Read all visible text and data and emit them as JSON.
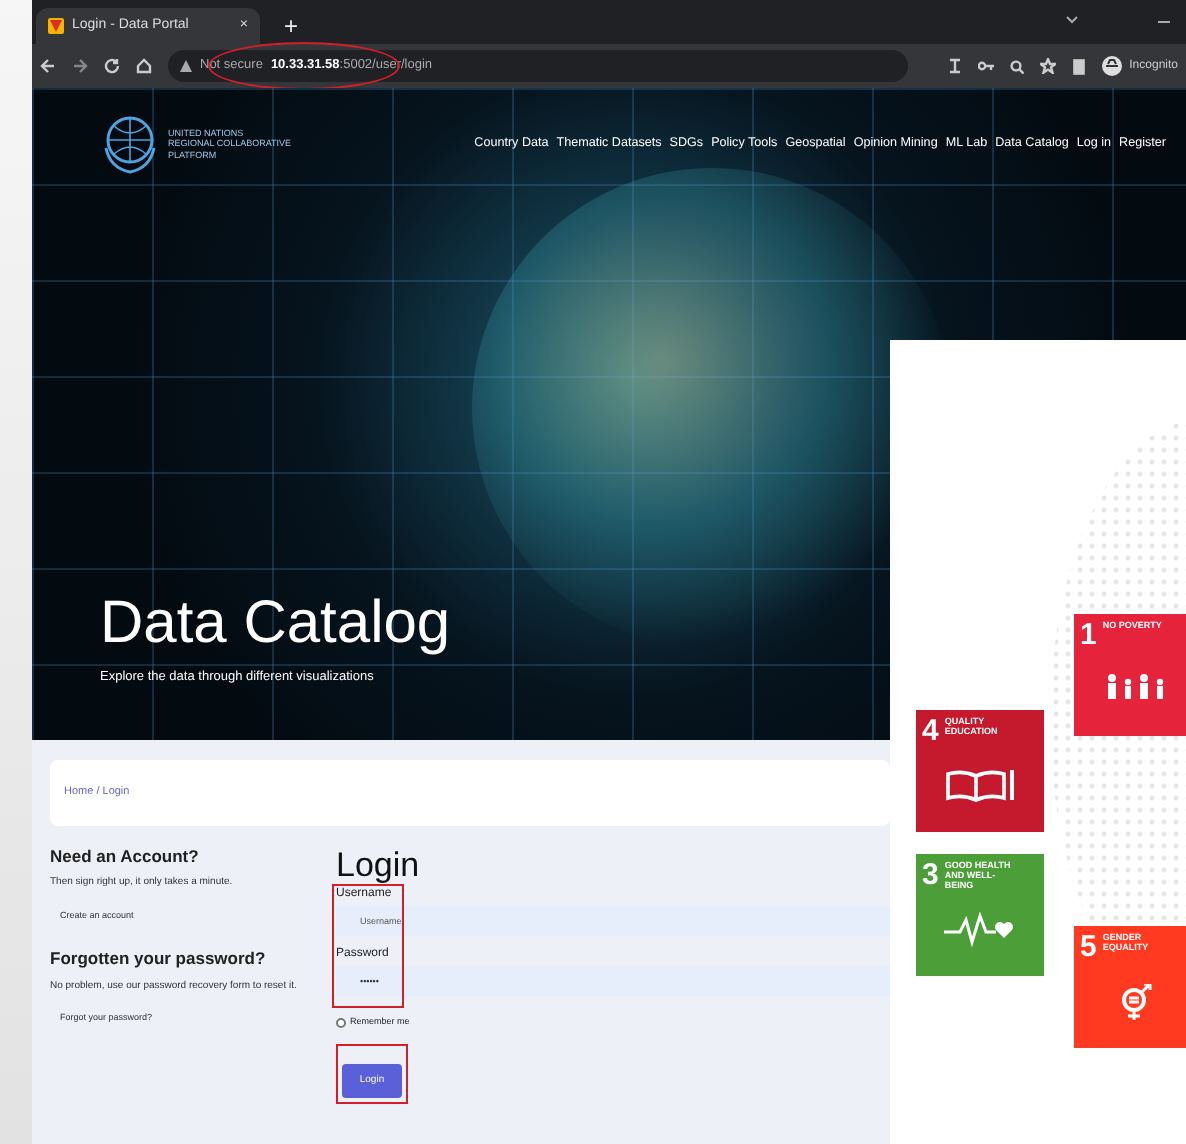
{
  "browser": {
    "tab_title": "Login - Data Portal",
    "tab_close": "×",
    "new_tab": "+",
    "security": "Not secure",
    "url_host": "10.33.31.58",
    "url_path": ":5002/user/login",
    "url_highlighted": true,
    "profile": "Incognito"
  },
  "site": {
    "logo_lines": [
      "UNITED NATIONS",
      "REGIONAL COLLABORATIVE",
      "PLATFORM"
    ],
    "nav": [
      "Country Data",
      "Thematic Datasets",
      "SDGs",
      "Policy Tools",
      "Geospatial",
      "Opinion Mining",
      "ML Lab",
      "Data Catalog",
      "Log in",
      "Register"
    ]
  },
  "hero": {
    "title": "Data Catalog",
    "subtitle": "Explore the data through different visualizations"
  },
  "breadcrumb": "Home / Login",
  "account": [
    {
      "heading": "Need an Account?",
      "text": "Then sign right up, it only takes a minute.",
      "link": "Create an account"
    },
    {
      "heading": "Forgotten your password?",
      "text": "No problem, use our password recovery form to reset it.",
      "link": "Forgot your password?"
    }
  ],
  "login": {
    "title": "Login",
    "fields_highlighted": true,
    "fields": [
      {
        "label": "Username",
        "placeholder": "Username"
      },
      {
        "label": "Password",
        "value": "••••••"
      }
    ],
    "remember": {
      "label": "Remember me",
      "checked": false
    },
    "button": {
      "label": "Login",
      "highlighted": true
    }
  },
  "sdg_tiles": [
    {
      "number": "1",
      "label": "NO POVERTY",
      "color": "#e5243b",
      "kind": "family"
    },
    {
      "number": "4",
      "label": "QUALITY EDUCATION",
      "color": "#c5192d",
      "kind": "book"
    },
    {
      "number": "3",
      "label": "GOOD HEALTH AND WELL-BEING",
      "color": "#4c9f38",
      "kind": "heartbeat"
    },
    {
      "number": "5",
      "label": "GENDER EQUALITY",
      "color": "#ff3a21",
      "kind": "gender"
    }
  ]
}
